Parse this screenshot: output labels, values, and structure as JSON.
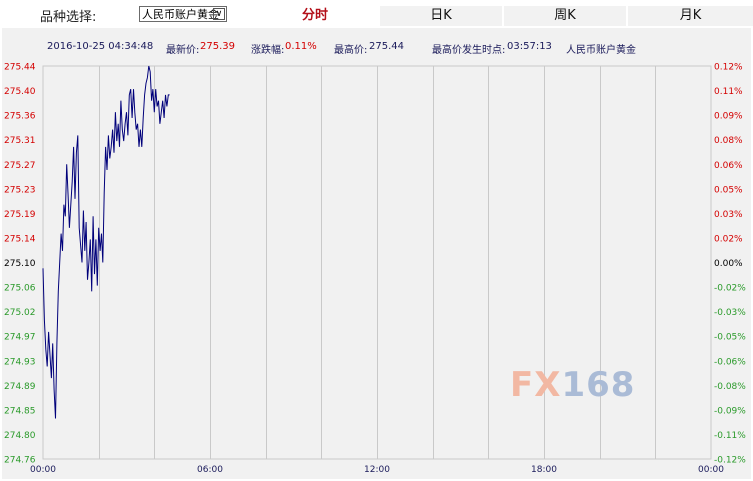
{
  "topbar": {
    "variety_label": "品种选择:",
    "variety_selected": "人民币账户黄金",
    "tabs": [
      {
        "label": "分时",
        "active": true
      },
      {
        "label": "日K",
        "active": false
      },
      {
        "label": "周K",
        "active": false
      },
      {
        "label": "月K",
        "active": false
      }
    ]
  },
  "info": {
    "datetime": "2016-10-25 04:34:48",
    "latest_label": "最新价:",
    "latest_value": "275.39",
    "change_label": "涨跌幅:",
    "change_value": "0.11%",
    "high_label": "最高价:",
    "high_value": "275.44",
    "high_time_label": "最高价发生时点:",
    "high_time_value": "03:57:13",
    "variety_name": "人民币账户黄金"
  },
  "watermark": {
    "part1": "FX",
    "part2": "168"
  },
  "colors": {
    "line": "#00007a",
    "up": "#d40000",
    "down": "#2a9a2a",
    "neutral": "#000000",
    "grid": "#c9c9c9",
    "panel": "#f1f1f1"
  },
  "chart_data": {
    "type": "line",
    "title": "",
    "xlabel": "",
    "ylabel": "",
    "base_price": 275.1,
    "x_ticks": [
      "00:00",
      "06:00",
      "12:00",
      "18:00",
      "00:00"
    ],
    "x_range_hours": [
      0,
      24
    ],
    "y_left_ticks": [
      "275.44",
      "275.40",
      "275.36",
      "275.31",
      "275.27",
      "275.23",
      "275.19",
      "275.14",
      "275.10",
      "275.06",
      "275.02",
      "274.97",
      "274.93",
      "274.89",
      "274.85",
      "274.80",
      "274.76"
    ],
    "y_right_ticks": [
      "0.12%",
      "0.11%",
      "0.09%",
      "0.08%",
      "0.06%",
      "0.05%",
      "0.03%",
      "0.02%",
      "0.00%",
      "-0.02%",
      "-0.03%",
      "-0.05%",
      "-0.06%",
      "-0.08%",
      "-0.09%",
      "-0.11%",
      "-0.12%"
    ],
    "ylim": [
      274.76,
      275.44
    ],
    "series": [
      {
        "x": [
          0.0,
          0.05,
          0.1,
          0.15,
          0.2,
          0.25,
          0.3,
          0.35,
          0.4,
          0.45,
          0.5,
          0.55,
          0.6,
          0.65,
          0.7,
          0.75,
          0.8,
          0.85,
          0.9,
          0.95,
          1.0,
          1.05,
          1.1,
          1.15,
          1.2,
          1.25,
          1.3,
          1.35,
          1.4,
          1.45,
          1.5,
          1.55,
          1.6,
          1.65,
          1.7,
          1.75,
          1.8,
          1.85,
          1.9,
          1.95,
          2.0,
          2.05,
          2.1,
          2.15,
          2.2,
          2.25,
          2.3,
          2.35,
          2.4,
          2.45,
          2.5,
          2.55,
          2.6,
          2.65,
          2.7,
          2.75,
          2.8,
          2.85,
          2.9,
          2.95,
          3.0,
          3.05,
          3.1,
          3.15,
          3.2,
          3.25,
          3.3,
          3.35,
          3.4,
          3.45,
          3.5,
          3.55,
          3.6,
          3.65,
          3.7,
          3.75,
          3.8,
          3.85,
          3.9,
          3.95,
          4.0,
          4.05,
          4.1,
          4.15,
          4.2,
          4.25,
          4.3,
          4.35,
          4.4,
          4.45,
          4.5,
          4.55
        ],
        "values": [
          275.09,
          275.0,
          274.95,
          274.92,
          274.98,
          274.94,
          274.9,
          274.96,
          274.88,
          274.83,
          274.96,
          275.05,
          275.1,
          275.15,
          275.12,
          275.2,
          275.18,
          275.27,
          275.22,
          275.16,
          275.2,
          275.24,
          275.3,
          275.21,
          275.29,
          275.32,
          275.16,
          275.13,
          275.1,
          275.19,
          275.12,
          275.17,
          275.07,
          275.1,
          275.14,
          275.05,
          275.18,
          275.08,
          275.14,
          275.06,
          275.16,
          275.12,
          275.15,
          275.1,
          275.22,
          275.3,
          275.26,
          275.32,
          275.28,
          275.3,
          275.33,
          275.29,
          275.36,
          275.31,
          275.34,
          275.3,
          275.38,
          275.33,
          275.31,
          275.34,
          275.36,
          275.32,
          275.39,
          275.4,
          275.35,
          275.4,
          275.36,
          275.33,
          275.34,
          275.3,
          275.33,
          275.3,
          275.35,
          275.39,
          275.41,
          275.42,
          275.44,
          275.43,
          275.38,
          275.4,
          275.36,
          275.4,
          275.37,
          275.38,
          275.34,
          275.36,
          275.38,
          275.35,
          275.39,
          275.37,
          275.39,
          275.39
        ]
      }
    ]
  }
}
